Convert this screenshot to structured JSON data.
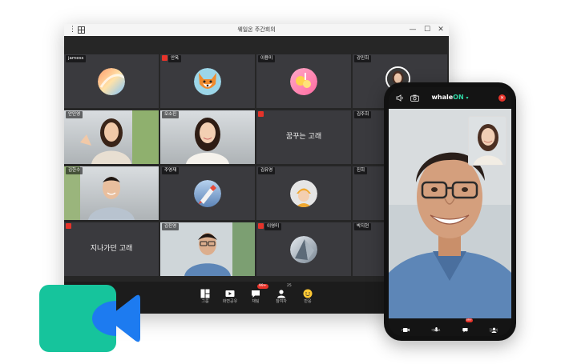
{
  "window": {
    "title": "웨일온 주간회의",
    "controls": {
      "minimize": "—",
      "maximize": "☐",
      "close": "✕"
    }
  },
  "participants": [
    {
      "name": "jamess",
      "muted": false,
      "type": "avatar",
      "avatar": "swirl"
    },
    {
      "name": "안옥",
      "muted": true,
      "type": "avatar",
      "avatar": "fox"
    },
    {
      "name": "이용미",
      "muted": false,
      "type": "avatar",
      "avatar": "drinks"
    },
    {
      "name": "강민희",
      "muted": false,
      "type": "blank"
    },
    {
      "name": "안민영",
      "muted": false,
      "type": "video",
      "avatar": "woman-wave"
    },
    {
      "name": "오소진",
      "muted": false,
      "type": "video",
      "avatar": "woman-smile"
    },
    {
      "name": "",
      "muted": true,
      "type": "text",
      "text": "꿈꾸는 고래"
    },
    {
      "name": "김주희",
      "muted": false,
      "type": "blank"
    },
    {
      "name": "김한수",
      "muted": false,
      "type": "video",
      "avatar": "man-smile"
    },
    {
      "name": "주영재",
      "muted": false,
      "type": "avatar",
      "avatar": "rocket"
    },
    {
      "name": "김유영",
      "muted": false,
      "type": "avatar",
      "avatar": "hat"
    },
    {
      "name": "진희",
      "muted": false,
      "type": "blank"
    },
    {
      "name": "",
      "muted": true,
      "type": "text",
      "text": "지나가던 고래"
    },
    {
      "name": "김진영",
      "muted": false,
      "type": "video",
      "avatar": "man-glasses"
    },
    {
      "name": "이영미",
      "muted": true,
      "type": "avatar",
      "avatar": "building"
    },
    {
      "name": "박지현",
      "muted": false,
      "type": "blank"
    }
  ],
  "toolbar": [
    {
      "label": "그룹",
      "icon": "layout-icon"
    },
    {
      "label": "화면공유",
      "icon": "screen-share-icon"
    },
    {
      "label": "채팅",
      "icon": "chat-icon",
      "badge": "99+"
    },
    {
      "label": "참여자",
      "icon": "participants-icon",
      "count": "25"
    },
    {
      "label": "반응",
      "icon": "emoji-icon"
    }
  ],
  "phone": {
    "brand_main": "whale",
    "brand_accent": "ON",
    "brand_caret": "▾",
    "end_call": "✕",
    "toolbar": [
      {
        "label": "카메라",
        "icon": "video-camera-icon"
      },
      {
        "label": "마이크",
        "icon": "microphone-icon"
      },
      {
        "label": "채팅",
        "icon": "chat-icon",
        "badge": "99+"
      },
      {
        "label": "참여자",
        "icon": "participants-icon"
      }
    ]
  },
  "colors": {
    "accent_green": "#16c49c",
    "accent_blue": "#1d7bf0",
    "mute_red": "#e6332a"
  }
}
